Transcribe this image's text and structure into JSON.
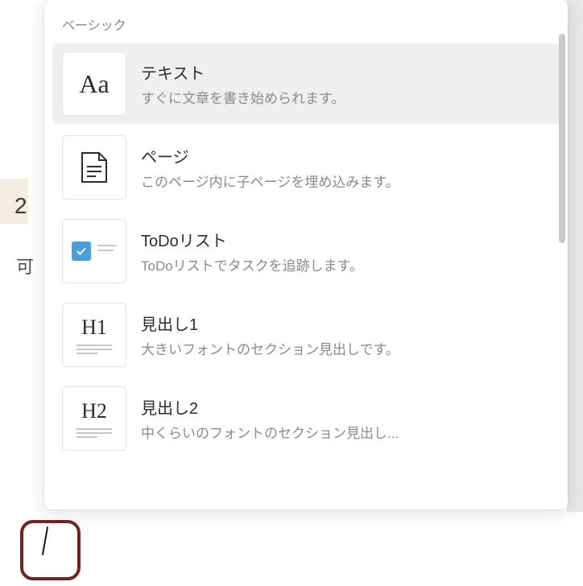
{
  "menu": {
    "section_label": "ベーシック",
    "items": [
      {
        "title": "テキスト",
        "description": "すぐに文章を書き始められます。",
        "icon_text": "Aa",
        "selected": true
      },
      {
        "title": "ページ",
        "description": "このページ内に子ページを埋め込みます。"
      },
      {
        "title": "ToDoリスト",
        "description": "ToDoリストでタスクを追跡します。"
      },
      {
        "title": "見出し1",
        "description": "大きいフォントのセクション見出しです。",
        "icon_text": "H1"
      },
      {
        "title": "見出し2",
        "description": "中くらいのフォントのセクション見出し...",
        "icon_text": "H2"
      }
    ]
  },
  "background": {
    "partial_text_1": "2",
    "partial_text_2": "可"
  }
}
